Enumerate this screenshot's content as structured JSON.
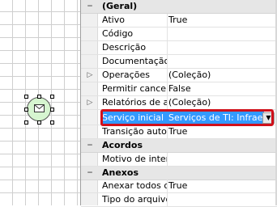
{
  "designer": {
    "shape_icon": "envelope-icon"
  },
  "property_grid": {
    "categories": [
      {
        "label": "(Geral)",
        "items": [
          {
            "name": "Ativo",
            "value": "True"
          },
          {
            "name": "Código",
            "value": ""
          },
          {
            "name": "Descrição",
            "value": ""
          },
          {
            "name": "Documentação d",
            "value": ""
          },
          {
            "name": "Operações",
            "value": "(Coleção)",
            "expandable": true
          },
          {
            "name": "Permitir cancela",
            "value": "False"
          },
          {
            "name": "Relatórios de ap",
            "value": "(Coleção)",
            "expandable": true
          },
          {
            "name": "Serviço inicial",
            "value": "Serviços de TI: Infraestr",
            "selected": true
          },
          {
            "name": "Transição autom",
            "value": "True"
          }
        ]
      },
      {
        "label": "Acordos",
        "items": [
          {
            "name": "Motivo de interr",
            "value": ""
          }
        ]
      },
      {
        "label": "Anexos",
        "items": [
          {
            "name": "Anexar todos os",
            "value": "True"
          },
          {
            "name": "Tipo do arquivo",
            "value": ""
          }
        ]
      }
    ],
    "collapse_glyph": "−",
    "expand_glyph": "▷",
    "dropdown_glyph": "▼"
  },
  "colors": {
    "selection": "#3399ff",
    "highlight_box": "#d0101a",
    "shape_fill": "#d6f5d0"
  }
}
